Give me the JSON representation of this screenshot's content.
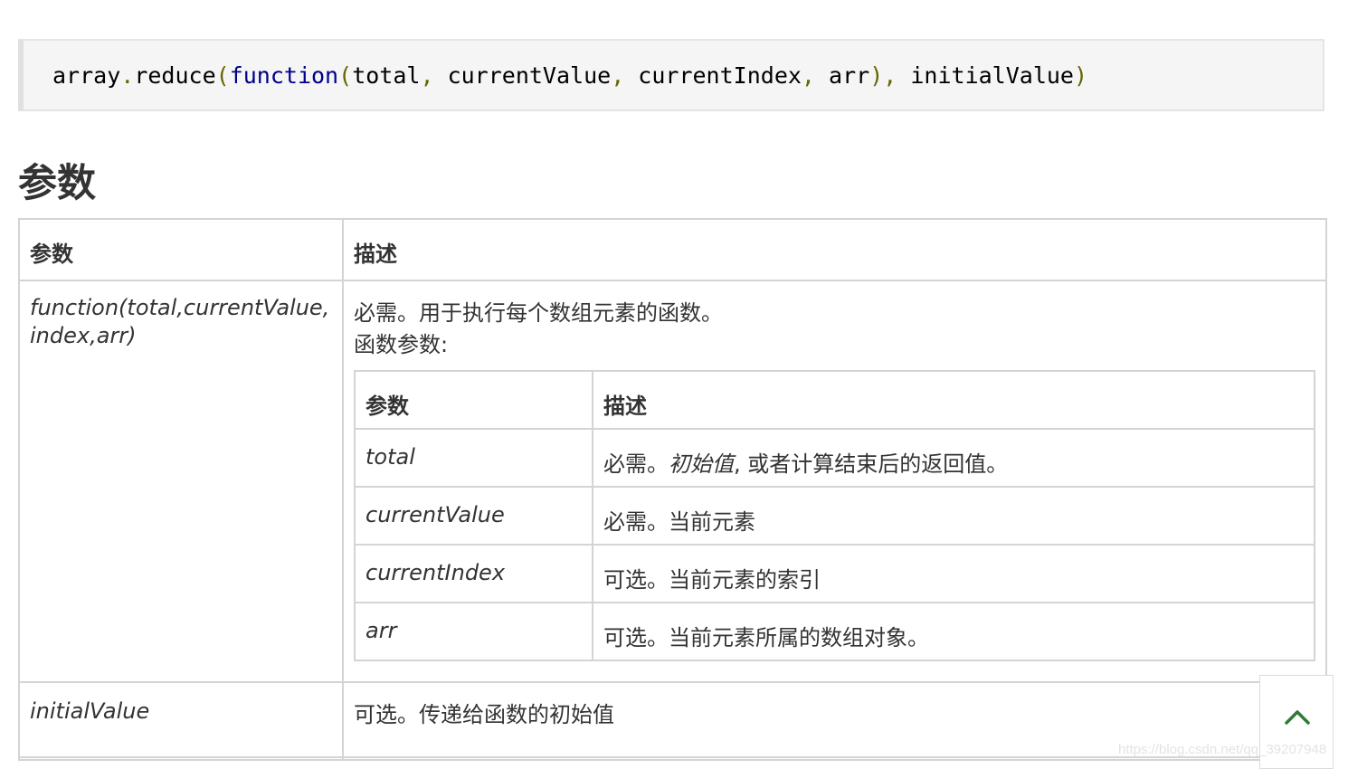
{
  "code": {
    "object": "array",
    "dot": ".",
    "method": "reduce",
    "open_paren": "(",
    "keyword": "function",
    "args_open": "(",
    "arg1": "total",
    "comma1": ",",
    "arg2": " currentValue",
    "comma2": ",",
    "arg3": " currentIndex",
    "comma3": ",",
    "arg4": " arr",
    "args_close": "),",
    "arg5": " initialValue",
    "close_paren": ")"
  },
  "section_title": "参数",
  "table": {
    "header": {
      "param": "参数",
      "desc": "描述"
    },
    "rows": [
      {
        "param_line1": "function(total,currentValue,",
        "param_line2": "index,arr)",
        "desc_line1": "必需。用于执行每个数组元素的函数。",
        "desc_line2": "函数参数:",
        "inner": {
          "header": {
            "param": "参数",
            "desc": "描述"
          },
          "rows": [
            {
              "name": "total",
              "desc_em": "初始值",
              "desc": "必需。",
              "desc_rest": ", 或者计算结束后的返回值。"
            },
            {
              "name": "currentValue",
              "desc": "必需。当前元素"
            },
            {
              "name": "currentIndex",
              "desc": "可选。当前元素的索引"
            },
            {
              "name": "arr",
              "desc": "可选。当前元素所属的数组对象。"
            }
          ]
        }
      },
      {
        "param": "initialValue",
        "desc": "可选。传递给函数的初始值"
      }
    ]
  },
  "watermark": "https://blog.csdn.net/qq_39207948",
  "scroll_top_icon": "chevron-up-icon"
}
